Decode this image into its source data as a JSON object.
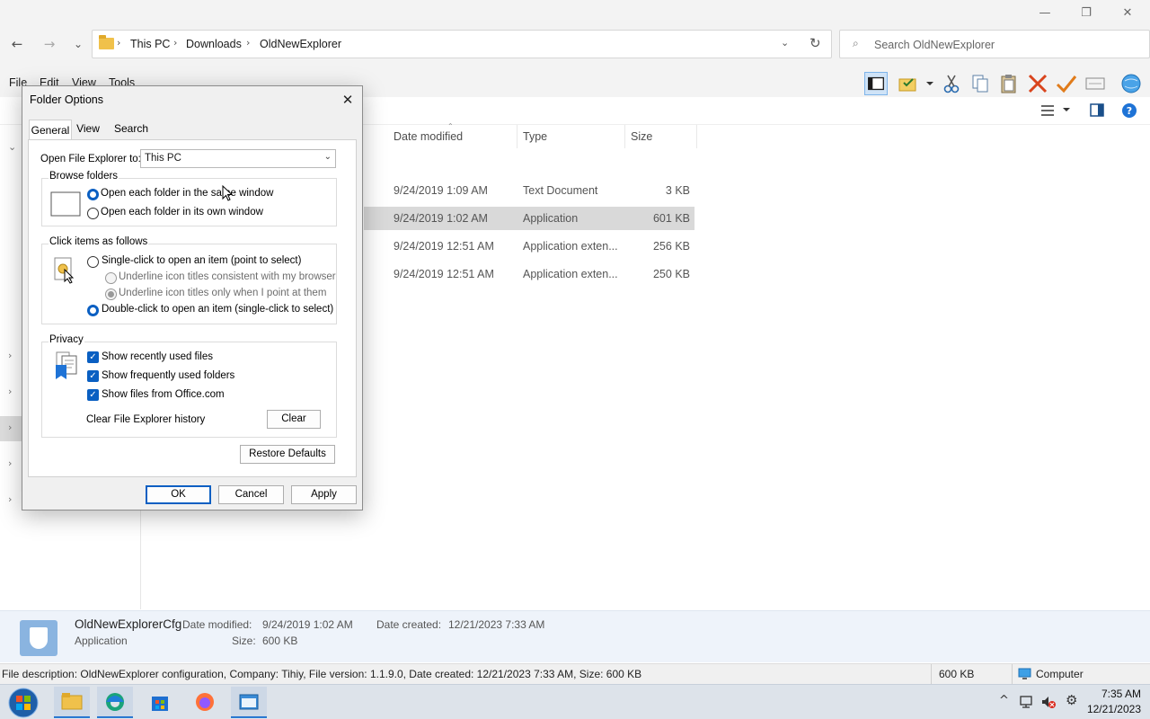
{
  "window": {
    "minimize": "—",
    "maximize": "❐",
    "close": "✕"
  },
  "nav": {
    "back": "←",
    "forward": "→",
    "recent": "⌄",
    "up": "↑"
  },
  "address": {
    "crumbs": [
      "This PC",
      "Downloads",
      "OldNewExplorer"
    ],
    "separator": "›"
  },
  "search": {
    "placeholder": "Search OldNewExplorer"
  },
  "menu": [
    "File",
    "Edit",
    "View",
    "Tools"
  ],
  "toolbar_icons": [
    "navigation-pane-icon",
    "properties-icon",
    "cut-icon",
    "copy-icon",
    "paste-icon",
    "delete-icon",
    "check-icon",
    "rename-icon",
    "globe-icon"
  ],
  "file_list": {
    "columns": [
      "Date modified",
      "Type",
      "Size"
    ],
    "rows": [
      {
        "date": "9/24/2019 1:09 AM",
        "type": "Text Document",
        "size": "3 KB",
        "selected": false
      },
      {
        "date": "9/24/2019 1:02 AM",
        "type": "Application",
        "size": "601 KB",
        "selected": true
      },
      {
        "date": "9/24/2019 12:51 AM",
        "type": "Application exten...",
        "size": "256 KB",
        "selected": false
      },
      {
        "date": "9/24/2019 12:51 AM",
        "type": "Application exten...",
        "size": "250 KB",
        "selected": false
      }
    ]
  },
  "details": {
    "name": "OldNewExplorerCfg",
    "type": "Application",
    "date_modified_label": "Date modified:",
    "date_modified": "9/24/2019 1:02 AM",
    "date_created_label": "Date created:",
    "date_created": "12/21/2023 7:33 AM",
    "size_label": "Size:",
    "size": "600 KB"
  },
  "status": {
    "description": "File description: OldNewExplorer configuration, Company: Tihiy, File version: 1.1.9.0, Date created: 12/21/2023 7:33 AM, Size: 600 KB",
    "size": "600 KB",
    "location": "Computer"
  },
  "taskbar": {
    "time": "7:35 AM",
    "date": "12/21/2023"
  },
  "dialog": {
    "title": "Folder Options",
    "tabs": [
      "General",
      "View",
      "Search"
    ],
    "open_to_label": "Open File Explorer to:",
    "open_to_value": "This PC",
    "browse": {
      "title": "Browse folders",
      "same_window": "Open each folder in the same window",
      "own_window": "Open each folder in its own window"
    },
    "click": {
      "title": "Click items as follows",
      "single": "Single-click to open an item (point to select)",
      "underline_browser": "Underline icon titles consistent with my browser",
      "underline_point": "Underline icon titles only when I point at them",
      "double": "Double-click to open an item (single-click to select)"
    },
    "privacy": {
      "title": "Privacy",
      "recent_files": "Show recently used files",
      "frequent_folders": "Show frequently used folders",
      "office": "Show files from Office.com",
      "clear_label": "Clear File Explorer history",
      "clear_button": "Clear"
    },
    "restore_defaults": "Restore Defaults",
    "ok": "OK",
    "cancel": "Cancel",
    "apply": "Apply"
  },
  "colors": {
    "accent": "#0a5fc2",
    "selection": "#d9d9d9",
    "details_bg": "#eef3fa"
  }
}
